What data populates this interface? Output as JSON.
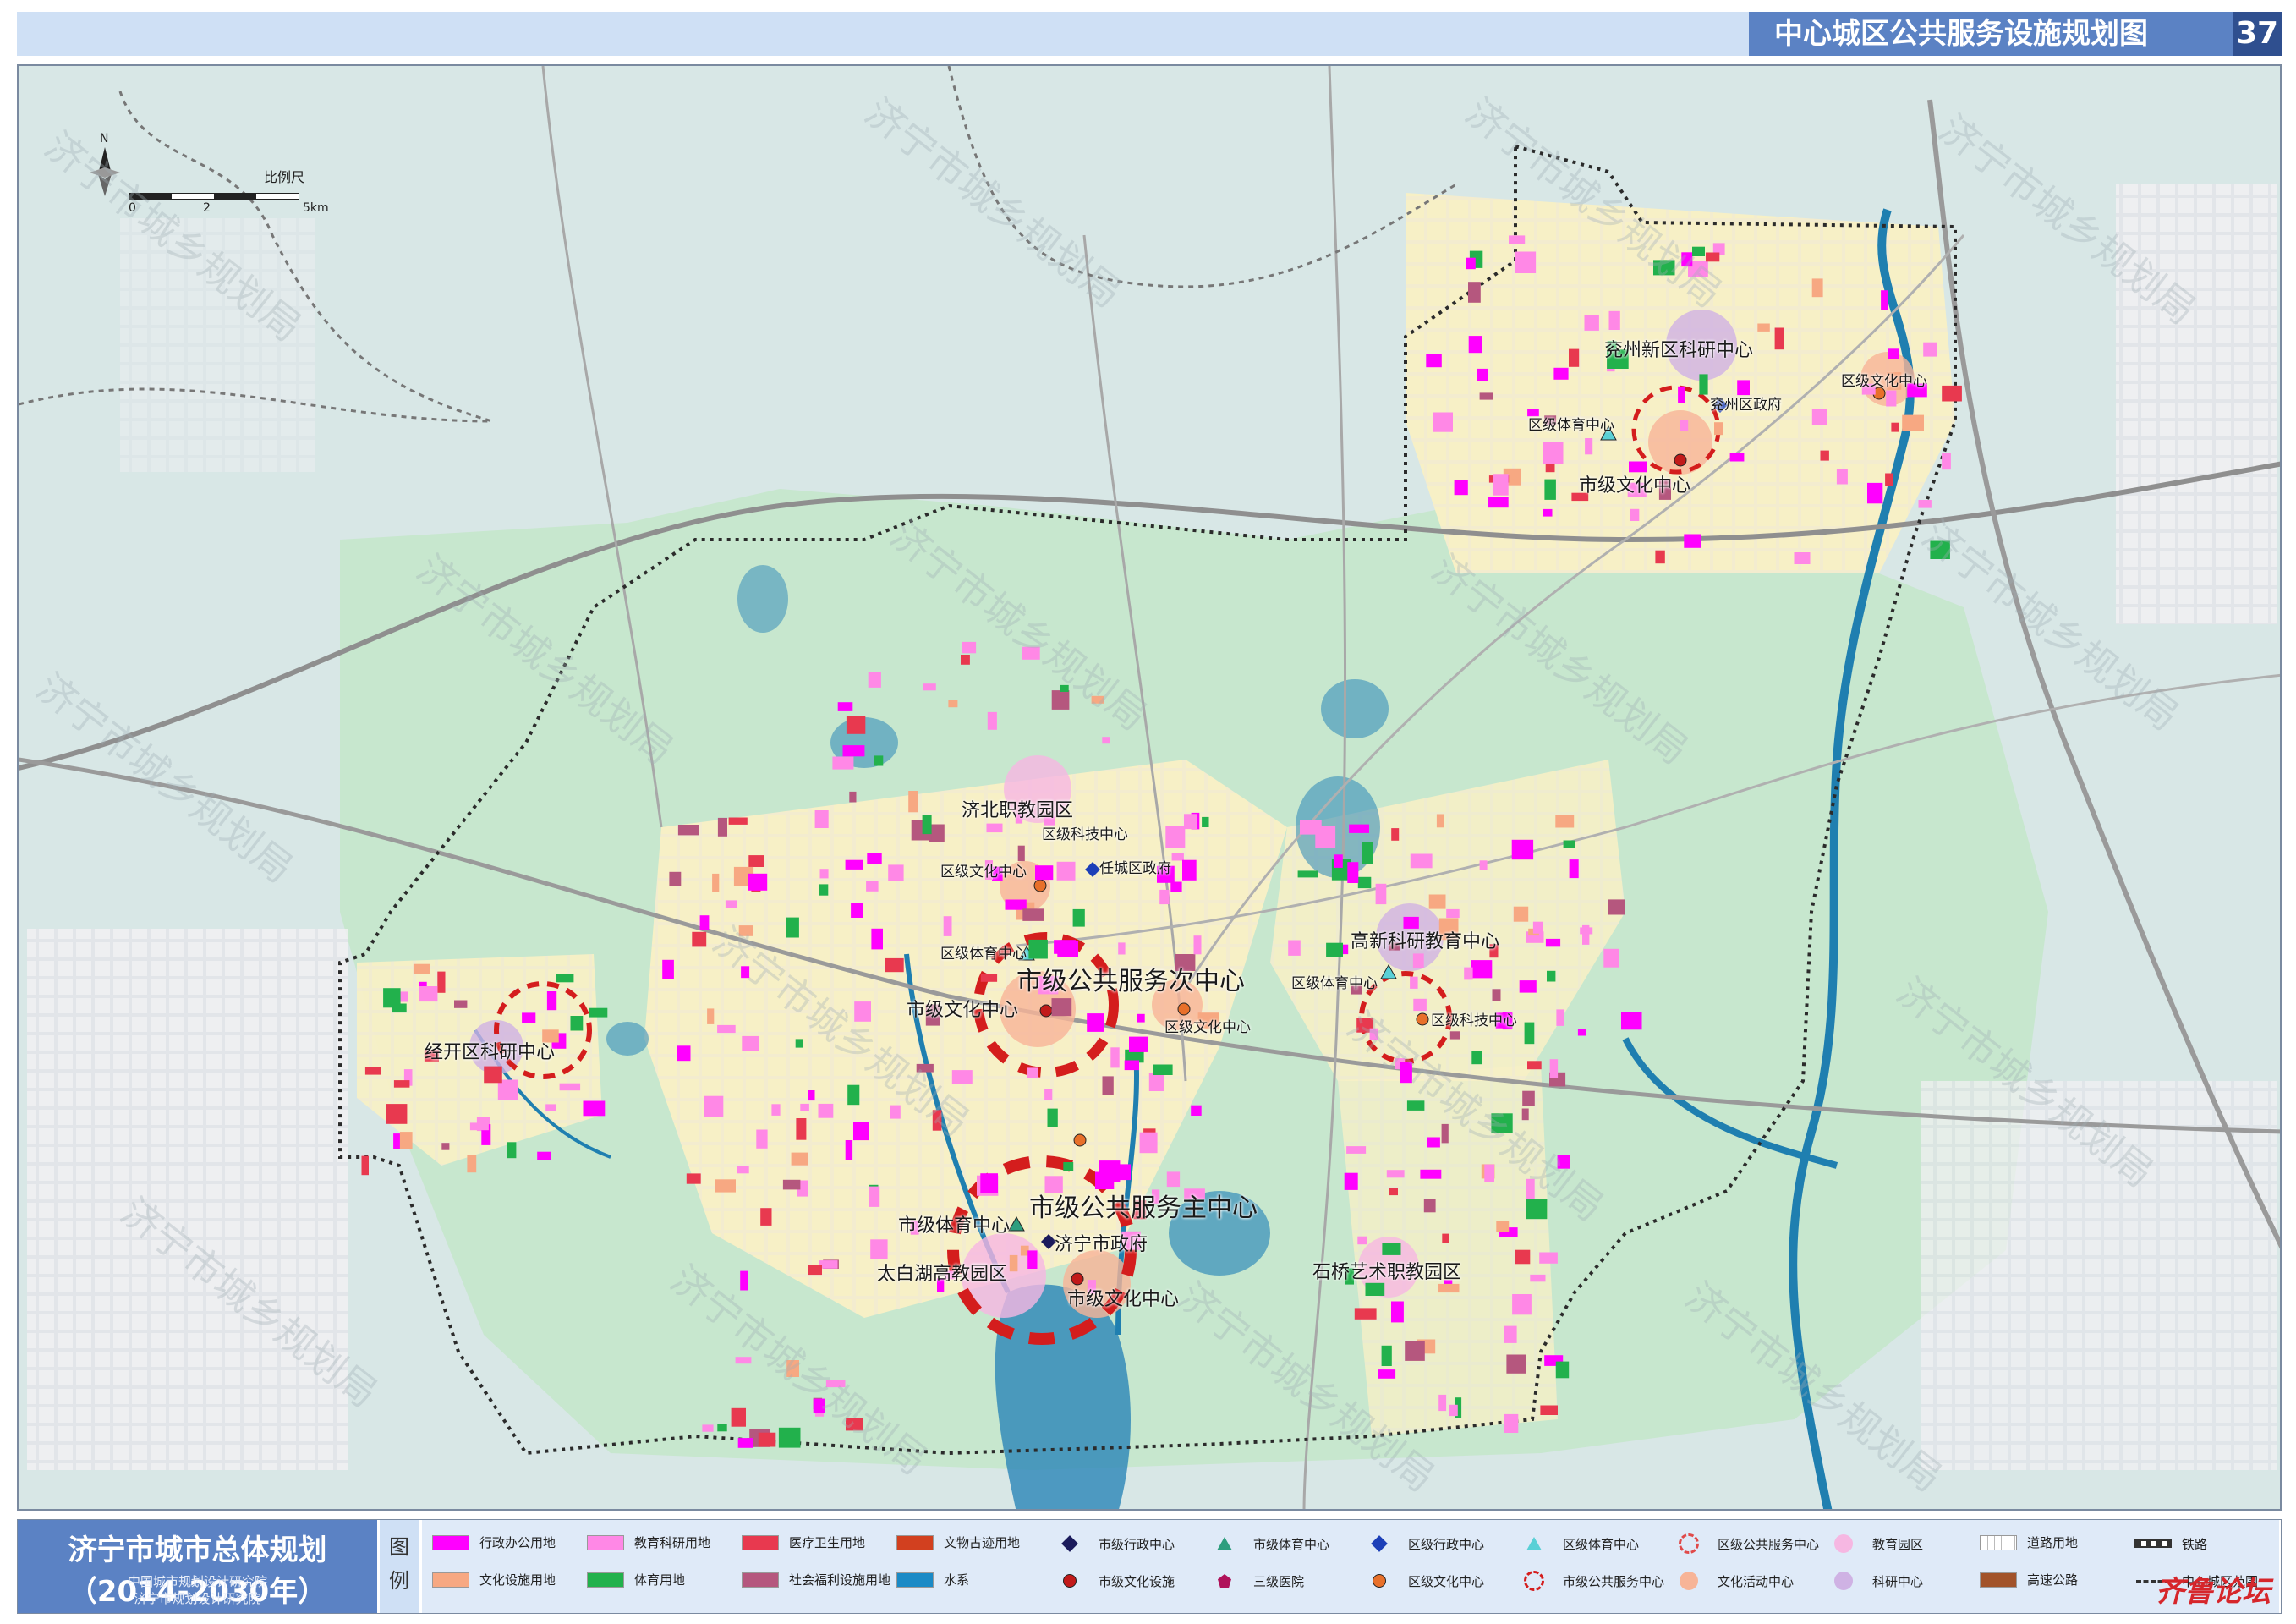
{
  "header": {
    "title": "中心城区公共服务设施规划图",
    "number": "37"
  },
  "compass": {
    "north": "N",
    "scale_label": "比例尺",
    "ticks": [
      "0",
      "2",
      "5km"
    ]
  },
  "watermark": "济宁市城乡规划局",
  "map_labels": {
    "yanzhou_research": "兖州新区科研中心",
    "yanzhou_culture_district": "区级文化中心",
    "yanzhou_sports": "区级体育中心",
    "yanzhou_gov": "兖州区政府",
    "yanzhou_city_culture": "市级文化中心",
    "jibei_edu": "济北职教园区",
    "rencheng_tech": "区级科技中心",
    "rencheng_culture": "区级文化中心",
    "rencheng_gov": "任城区政府",
    "rencheng_sports": "区级体育中心",
    "sub_center": "市级公共服务次中心",
    "sub_city_culture": "市级文化中心",
    "jingkai_research": "经开区科研中心",
    "gaoxin_edu": "高新科研教育中心",
    "gaoxin_sports": "区级体育中心",
    "gaoxin_tech": "区级科技中心",
    "mid_culture": "区级文化中心",
    "main_center": "市级公共服务主中心",
    "city_sports": "市级体育中心",
    "city_gov": "济宁市政府",
    "taibaihu_edu": "太白湖高教园区",
    "main_city_culture": "市级文化中心",
    "shiqiao_edu": "石桥艺术职教园区"
  },
  "footer": {
    "plan_title": "济宁市城市总体规划（2014-2030年）",
    "org1": "中国城市规划设计研究院",
    "org2": "济宁市规划设计研究院",
    "legend_head_1": "图",
    "legend_head_2": "例",
    "logo": "齐鲁论坛"
  },
  "legend": [
    {
      "label": "行政办公用地",
      "kind": "swatch",
      "color": "#ff00ff"
    },
    {
      "label": "文化设施用地",
      "kind": "swatch",
      "color": "#f7a882"
    },
    {
      "label": "教育科研用地",
      "kind": "swatch",
      "color": "#ff88e6"
    },
    {
      "label": "体育用地",
      "kind": "swatch",
      "color": "#22b14c"
    },
    {
      "label": "医疗卫生用地",
      "kind": "swatch",
      "color": "#e8394f"
    },
    {
      "label": "社会福利设施用地",
      "kind": "swatch",
      "color": "#b5577e"
    },
    {
      "label": "文物古迹用地",
      "kind": "swatch",
      "color": "#d2401f"
    },
    {
      "label": "水系",
      "kind": "swatch",
      "color": "#1a8ac6"
    },
    {
      "label": "市级行政中心",
      "kind": "diamond",
      "color": "#1b1b5c"
    },
    {
      "label": "市级文化设施",
      "kind": "dot",
      "color": "#c21a1a"
    },
    {
      "label": "市级体育中心",
      "kind": "triangle",
      "color": "#2e9e7e"
    },
    {
      "label": "三级医院",
      "kind": "pentagon",
      "color": "#b0125a"
    },
    {
      "label": "区级行政中心",
      "kind": "diamond",
      "color": "#1c3fb8"
    },
    {
      "label": "区级文化中心",
      "kind": "dot",
      "color": "#e8702a"
    },
    {
      "label": "区级体育中心",
      "kind": "triangle",
      "color": "#59d0d6"
    },
    {
      "label": "市级公共服务中心",
      "kind": "dashring",
      "color": "#d41d1d"
    },
    {
      "label": "区级公共服务中心",
      "kind": "dashring",
      "color": "#e04a4a"
    },
    {
      "label": "文化活动中心",
      "kind": "circle",
      "color": "#f7b497"
    },
    {
      "label": "教育园区",
      "kind": "circle",
      "color": "#f6b7e2"
    },
    {
      "label": "科研中心",
      "kind": "circle",
      "color": "#cfb2e4"
    },
    {
      "label": "道路用地",
      "kind": "grid",
      "color": "#ffffff"
    },
    {
      "label": "高速公路",
      "kind": "swatch",
      "color": "#a2532a"
    },
    {
      "label": "铁路",
      "kind": "rail",
      "color": "#333333"
    },
    {
      "label": "中心城区范围",
      "kind": "dashline",
      "color": "#333333"
    }
  ]
}
